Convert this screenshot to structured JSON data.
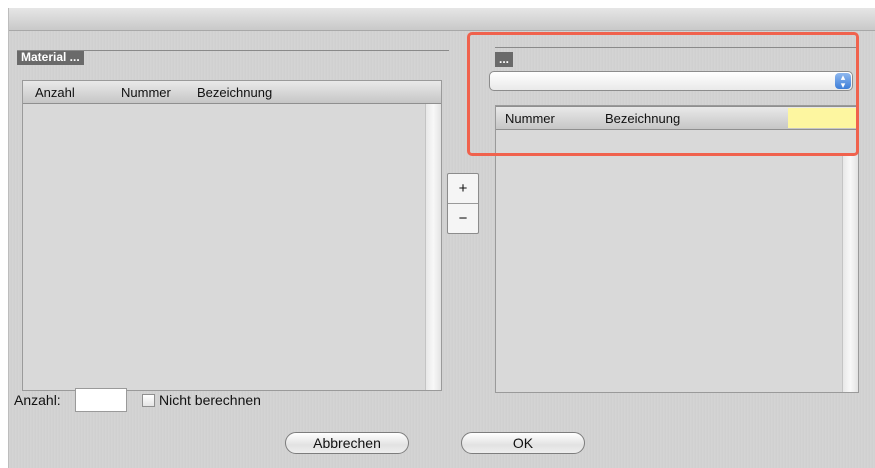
{
  "left_section": {
    "title": "Material ...",
    "columns": [
      "Anzahl",
      "Nummer",
      "Bezeichnung"
    ],
    "rows": []
  },
  "right_section": {
    "title": "...",
    "popup": {
      "selected": ""
    },
    "columns": [
      "Nummer",
      "Bezeichnung"
    ],
    "rows": []
  },
  "stepper": {
    "plus": "+",
    "minus": "−"
  },
  "footer": {
    "anzahl_label": "Anzahl:",
    "anzahl_value": "",
    "nicht_berechnen_label": "Nicht berechnen",
    "nicht_berechnen_checked": false,
    "cancel_label": "Abbrechen",
    "ok_label": "OK"
  },
  "colors": {
    "highlight": "#f0624d",
    "yellow_cell": "#fdf6a0",
    "popup_accent": "#3d7ed8"
  }
}
